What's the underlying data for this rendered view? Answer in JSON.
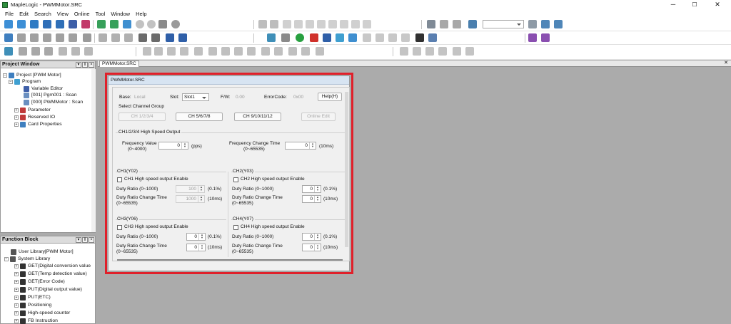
{
  "window": {
    "title": "MapleLogic - PWMMotor.SRC",
    "minimize": "─",
    "maximize": "☐",
    "close": "✕"
  },
  "menu": [
    "File",
    "Edit",
    "Search",
    "View",
    "Online",
    "Tool",
    "Window",
    "Help"
  ],
  "project_window": {
    "title": "Project Window",
    "items": [
      {
        "label": "Project [PWM Motor]"
      },
      {
        "label": "Program"
      },
      {
        "label": "Variable Editor"
      },
      {
        "label": "[001] Pgm001 : Scan"
      },
      {
        "label": "[000] PWMMotor : Scan"
      },
      {
        "label": "Parameter"
      },
      {
        "label": "Reserved IO"
      },
      {
        "label": "Card Properties"
      }
    ]
  },
  "function_block": {
    "title": "Function Block",
    "items": [
      {
        "label": "User Library[PWM Motor]"
      },
      {
        "label": "System Library"
      },
      {
        "label": "GET(Digital conversion value"
      },
      {
        "label": "GET(Temp detection value)"
      },
      {
        "label": "GET(Error Code)"
      },
      {
        "label": "PUT(Digital output value)"
      },
      {
        "label": "PUT(ETC)"
      },
      {
        "label": "Positioning"
      },
      {
        "label": "High-speed counter"
      },
      {
        "label": "FB Instruction"
      }
    ]
  },
  "panel_buttons": {
    "pin": "▾",
    "float": "ǁ",
    "close": "×"
  },
  "doc_tab": {
    "label": "PWMMotor.SRC"
  },
  "dialog": {
    "title": "PWMMotor.SRC",
    "base_label": "Base:",
    "base_value": "Local",
    "slot_label": "Slot:",
    "slot_value": "Slot1",
    "fw_label": "F/W:",
    "fw_value": "0.00",
    "error_label": "ErrorCode:",
    "error_value": "0x00",
    "help": "Help(H)",
    "select_group": "Select Channel Group",
    "groups": [
      "CH 1/2/3/4",
      "CH 5/6/7/8",
      "CH 9/10/11/12"
    ],
    "online_edit": "Online Edit",
    "hs_output": "CH1/2/3/4 High Speed Output",
    "freq_label": "Frequency Value",
    "freq_range": "(0~4000)",
    "freq_value": "0",
    "freq_unit": "(pps)",
    "fct_label": "Frequency Change Time",
    "fct_range": "(0~65535)",
    "fct_value": "0",
    "fct_unit": "(10ms)",
    "channels": [
      {
        "title": "CH1(Y02)",
        "enable": "CH1 High speed output Enable",
        "duty_label": "Duty Ratio (0~1000)",
        "duty_value": "100",
        "duty_unit": "(0.1%)",
        "dct_label": "Duty Ratio Change Time",
        "dct_range": "(0~65535)",
        "dct_value": "1000",
        "dct_unit": "(10ms)"
      },
      {
        "title": "CH2(Y03)",
        "enable": "CH2 High speed output Enable",
        "duty_label": "Duty Ratio (0~1000)",
        "duty_value": "0",
        "duty_unit": "(0.1%)",
        "dct_label": "Duty Ratio Change Time",
        "dct_range": "(0~65535)",
        "dct_value": "0",
        "dct_unit": "(10ms)"
      },
      {
        "title": "CH3(Y06)",
        "enable": "CH3 High speed output Enable",
        "duty_label": "Duty Ratio (0~1000)",
        "duty_value": "0",
        "duty_unit": "(0.1%)",
        "dct_label": "Duty Ratio Change Time",
        "dct_range": "(0~65535)",
        "dct_value": "0",
        "dct_unit": "(10ms)"
      },
      {
        "title": "CH4(Y07)",
        "enable": "CH4 High speed output Enable",
        "duty_label": "Duty Ratio (0~1000)",
        "duty_value": "0",
        "duty_unit": "(0.1%)",
        "dct_label": "Duty Ratio Change Time",
        "dct_range": "(0~65535)",
        "dct_value": "0",
        "dct_unit": "(10ms)"
      }
    ]
  }
}
